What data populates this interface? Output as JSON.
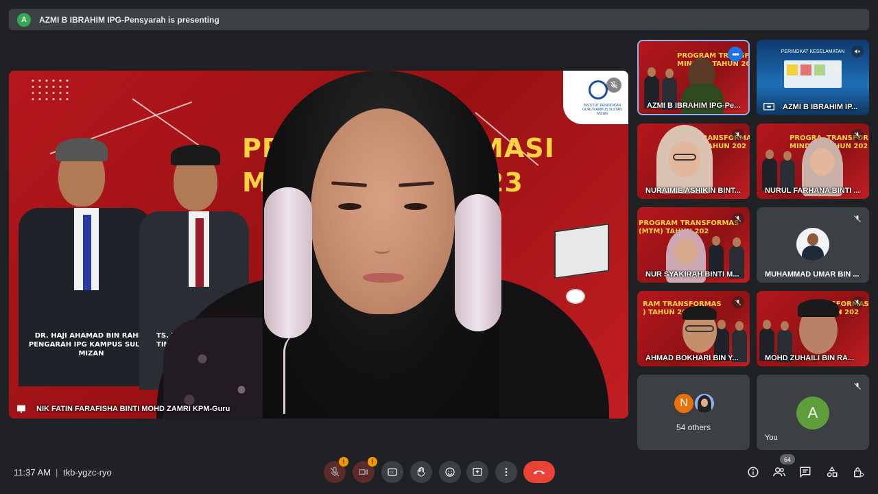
{
  "banner": {
    "avatar_letter": "A",
    "text": "AZMI B IBRAHIM IPG-Pensyarah is presenting"
  },
  "main_stage": {
    "slide_title": "PROG       SFORMASI\nM              IN 2023",
    "logo_text": "INSTITUT PENDIDIKAN GURU KAMPUS SULTAN MIZAN",
    "person1_caption": "DR. HAJI AHAMAD BIN RAHIM\nPENGARAH\nIPG KAMPUS SULTAN MIZAN",
    "person2_caption": "TS. DR. PA\nTIN\nIPG",
    "name_label": "NIK FATIN FARAFISHA BINTI MOHD ZAMRI KPM-Guru"
  },
  "tiles": [
    {
      "name": "AZMI B IBRAHIM IPG-Pe...",
      "mini_title": "PROGRAM TRANSFORMAS\nMIND      TAHUN 202"
    },
    {
      "name": "AZMI B IBRAHIM IP...",
      "slide_heading": "PERINGKAT KESELAMATAN"
    },
    {
      "name": "NURAIMIE ASHIKIN BINT...",
      "mini_title": "TRANSFORMAS\n) TAHUN 202"
    },
    {
      "name": "NURUL FARHANA BINTI ...",
      "mini_title": "PROGRA  TRANSFORMAS\nMIND      TAHUN 202"
    },
    {
      "name": "NUR SYAKIRAH BINTI M...",
      "mini_title": "PROGRAM TRANSFORMAS\n(MTM) TAHUN 202"
    },
    {
      "name": "MUHAMMAD UMAR BIN ..."
    },
    {
      "name": "AHMAD BOKHARI BIN Y...",
      "mini_title": "RAM TRANSFORMAS\n) TAHUN 202"
    },
    {
      "name": "MOHD ZUHAILI BIN RA...",
      "mini_title": "TRANSFORMAS\n) TAHUN 202"
    },
    {
      "others_letter": "N",
      "others_label": "54 others"
    },
    {
      "name": "You",
      "avatar_letter": "A"
    }
  ],
  "bottom_bar": {
    "time": "11:37 AM",
    "separator": "|",
    "meeting_code": "tkb-ygzc-ryo",
    "mic_badge": "!",
    "cam_badge": "!",
    "participants_count": "64"
  },
  "colors": {
    "background": "#202124",
    "tile": "#3c4043",
    "accent_blue": "#8ab4f8",
    "danger": "#ea4335",
    "warning": "#f29900",
    "slide_red": "#b5171c",
    "slide_yellow": "#ffd23f"
  }
}
